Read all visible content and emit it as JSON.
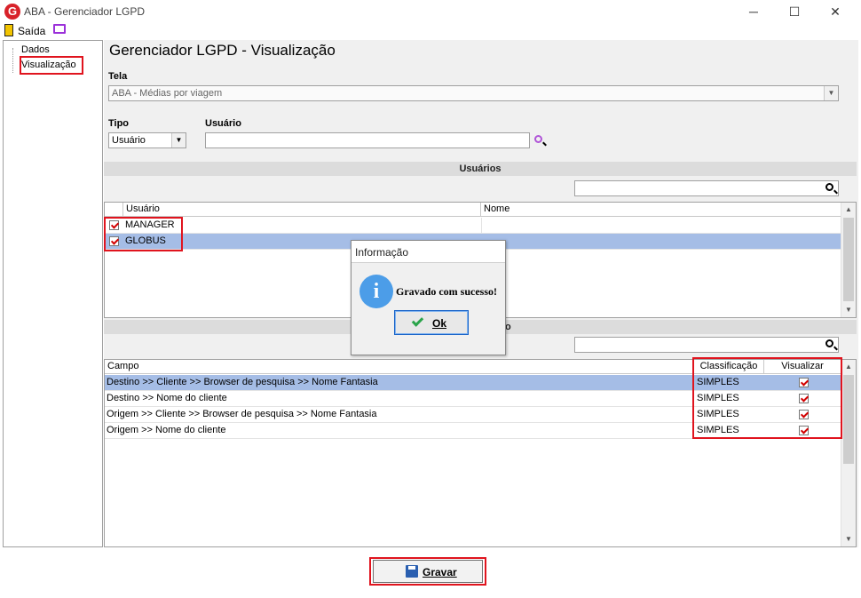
{
  "window": {
    "title": "ABA - Gerenciador LGPD",
    "logo_letter": "G",
    "minimize": "─",
    "maximize": "☐",
    "close": "✕"
  },
  "menu": {
    "exit_label": "Saída"
  },
  "tree": {
    "items": [
      "Dados",
      "Visualização"
    ]
  },
  "page": {
    "title": "Gerenciador LGPD - Visualização",
    "tela_label": "Tela",
    "tela_value": "ABA - Médias por viagem",
    "tipo_label": "Tipo",
    "tipo_value": "Usuário",
    "usuario_label": "Usuário",
    "usuario_value": ""
  },
  "users_section": {
    "title": "Usuários",
    "search_value": "",
    "columns": [
      "Usuário",
      "Nome"
    ],
    "rows": [
      {
        "usuario": "MANAGER",
        "nome": "",
        "checked": true,
        "selected": false
      },
      {
        "usuario": "GLOBUS",
        "nome": "",
        "checked": true,
        "selected": true
      }
    ]
  },
  "fields_section": {
    "title_visible": "o",
    "search_value": "",
    "columns": [
      "Campo",
      "Classificação",
      "Visualizar"
    ],
    "rows": [
      {
        "campo": "Destino >> Cliente >> Browser de pesquisa >> Nome Fantasia",
        "classificacao": "SIMPLES",
        "visualizar": true,
        "selected": true
      },
      {
        "campo": "Destino >> Nome do cliente",
        "classificacao": "SIMPLES",
        "visualizar": true,
        "selected": false
      },
      {
        "campo": "Origem >> Cliente >> Browser de pesquisa >> Nome Fantasia",
        "classificacao": "SIMPLES",
        "visualizar": true,
        "selected": false
      },
      {
        "campo": "Origem >> Nome do cliente",
        "classificacao": "SIMPLES",
        "visualizar": true,
        "selected": false
      }
    ]
  },
  "dialog": {
    "title": "Informação",
    "icon_glyph": "i",
    "message": "Gravado com sucesso!",
    "ok_label": "Ok"
  },
  "footer": {
    "save_label": "Gravar"
  },
  "colors": {
    "highlight": "#e0141e",
    "selection": "#a5bde6",
    "check": "#d20000"
  }
}
